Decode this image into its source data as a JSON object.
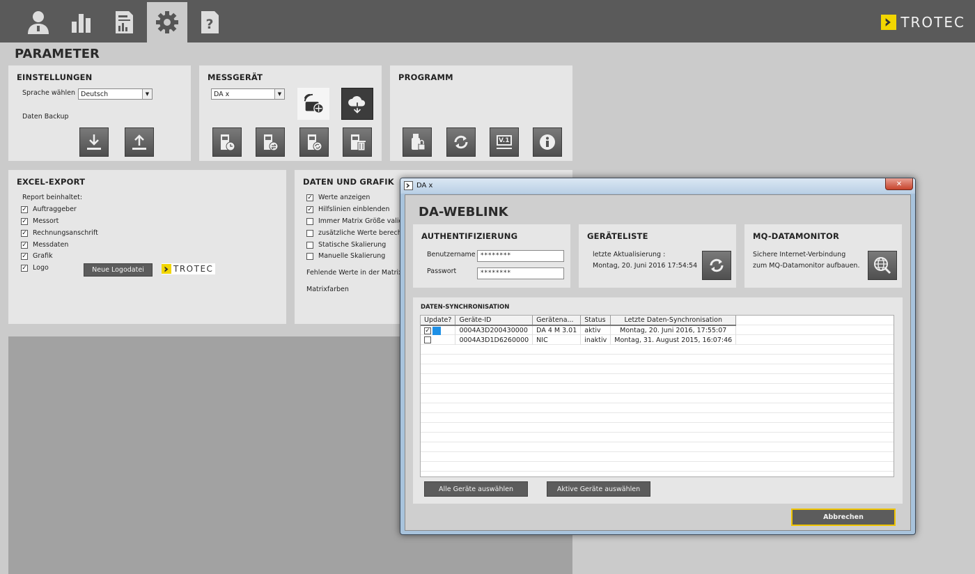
{
  "nav": {
    "items": [
      {
        "name": "user-icon"
      },
      {
        "name": "bar-chart-icon"
      },
      {
        "name": "report-icon"
      },
      {
        "name": "gear-icon"
      },
      {
        "name": "help-icon"
      }
    ],
    "active": "gear-icon",
    "logo": "TROTEC"
  },
  "page_title": "PARAMETER",
  "einstellungen": {
    "title": "EINSTELLUNGEN",
    "language_label": "Sprache wählen",
    "language_value": "Deutsch",
    "backup_label": "Daten Backup"
  },
  "messgeraet": {
    "title": "MESSGERÄT",
    "device_value": "DA x"
  },
  "programm": {
    "title": "PROGRAMM",
    "version_label": "V.1"
  },
  "excel": {
    "title": "EXCEL-EXPORT",
    "report_label": "Report beinhaltet:",
    "options": [
      {
        "label": "Auftraggeber",
        "checked": true
      },
      {
        "label": "Messort",
        "checked": true
      },
      {
        "label": "Rechnungsanschrift",
        "checked": true
      },
      {
        "label": "Messdaten",
        "checked": true
      },
      {
        "label": "Grafik",
        "checked": true
      },
      {
        "label": "Logo",
        "checked": true
      }
    ],
    "logo_button": "Neue Logodatei",
    "logo_text": "TROTEC"
  },
  "daten": {
    "title": "DATEN UND GRAFIK",
    "options": [
      {
        "label": "Werte anzeigen",
        "checked": true
      },
      {
        "label": "Hilfslinien einblenden",
        "checked": true
      },
      {
        "label": "Immer Matrix Größe validier",
        "checked": false
      },
      {
        "label": "zusätzliche Werte berechne",
        "checked": false
      },
      {
        "label": "Statische Skalierung",
        "checked": false
      },
      {
        "label": "Manuelle Skalierung",
        "checked": false
      }
    ],
    "missing_label": "Fehlende Werte in der Matrix",
    "colors_label": "Matrixfarben"
  },
  "dialog": {
    "window_title": "DA x",
    "close_label": "✕",
    "heading": "DA-WEBLINK",
    "auth": {
      "title": "AUTHENTIFIZIERUNG",
      "user_label": "Benutzername",
      "user_value": "********",
      "pass_label": "Passwort",
      "pass_value": "********"
    },
    "geraeteliste": {
      "title": "GERÄTELISTE",
      "update_label": "letzte Aktualisierung :",
      "update_value": "Montag, 20. Juni 2016 17:54:54"
    },
    "mq": {
      "title": "MQ-DATAMONITOR",
      "line1": "Sichere Internet-Verbindung",
      "line2": "zum MQ-Datamonitor aufbauen."
    },
    "sync": {
      "title": "DATEN-SYNCHRONISATION",
      "columns": [
        "Update?",
        "Geräte-ID",
        "Gerätena...",
        "Status",
        "Letzte Daten-Synchronisation"
      ],
      "rows": [
        {
          "checked": true,
          "id": "0004A3D200430000",
          "name": "DA 4 M 3.01",
          "status": "aktiv",
          "last": "Montag, 20. Juni 2016, 17:55:07"
        },
        {
          "checked": false,
          "id": "0004A3D1D6260000",
          "name": "NIC",
          "status": "inaktiv",
          "last": "Montag, 31. August 2015, 16:07:46"
        }
      ],
      "select_all": "Alle Geräte auswählen",
      "select_active": "Aktive Geräte auswählen"
    },
    "cancel": "Abbrechen"
  }
}
